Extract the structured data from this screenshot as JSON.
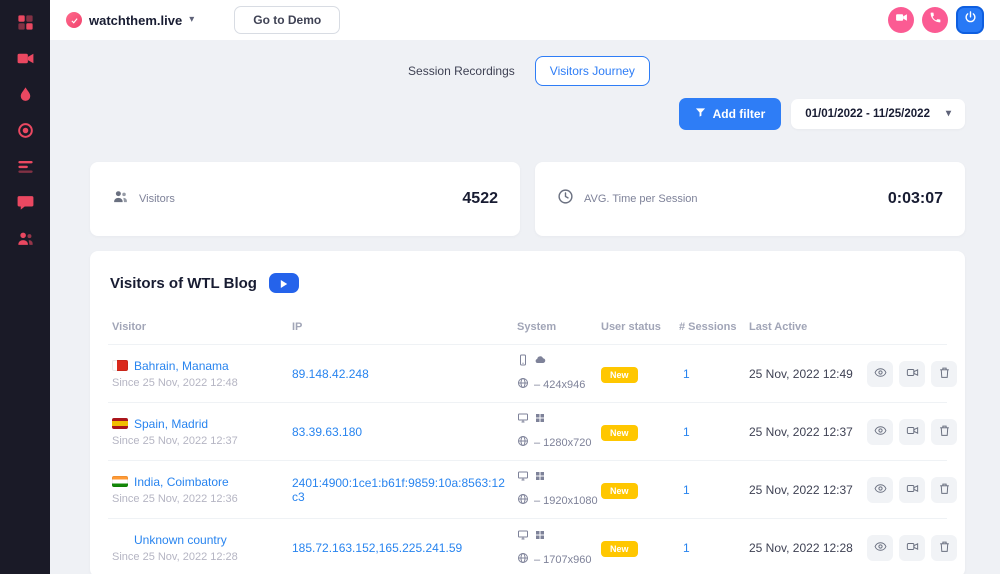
{
  "colors": {
    "accent_pink": "#f1416c",
    "accent_blue": "#2e7df6",
    "badge_yellow": "#ffc700",
    "sidebar_bg": "#1a1a27"
  },
  "icons": {
    "chevron_down": "▾"
  },
  "header": {
    "brand": "watchthem.live",
    "demo_button": "Go to Demo"
  },
  "tabs": {
    "session_recordings": "Session Recordings",
    "visitors_journey": "Visitors Journey"
  },
  "toolbar": {
    "add_filter": "Add filter",
    "date_range": "01/01/2022 - 11/25/2022"
  },
  "stats": {
    "visitors_label": "Visitors",
    "visitors_value": "4522",
    "avg_label": "AVG. Time per Session",
    "avg_value": "0:03:07"
  },
  "table": {
    "title": "Visitors of WTL Blog",
    "columns": [
      "Visitor",
      "IP",
      "System",
      "User status",
      "# Sessions",
      "Last Active"
    ],
    "rows": [
      {
        "location": "Bahrain, Manama",
        "since": "Since 25 Nov, 2022 12:48",
        "ip": "89.148.42.248",
        "resolution": "– 424x946",
        "status": "New",
        "sessions": "1",
        "last_active": "25 Nov, 2022 12:49"
      },
      {
        "location": "Spain, Madrid",
        "since": "Since 25 Nov, 2022 12:37",
        "ip": "83.39.63.180",
        "resolution": "– 1280x720",
        "status": "New",
        "sessions": "1",
        "last_active": "25 Nov, 2022 12:37"
      },
      {
        "location": "India, Coimbatore",
        "since": "Since 25 Nov, 2022 12:36",
        "ip": "2401:4900:1ce1:b61f:9859:10a:8563:12c3",
        "resolution": "– 1920x1080",
        "status": "New",
        "sessions": "1",
        "last_active": "25 Nov, 2022 12:37"
      },
      {
        "location": "Unknown country",
        "since": "Since 25 Nov, 2022 12:28",
        "ip": "185.72.163.152,165.225.241.59",
        "resolution": "– 1707x960",
        "status": "New",
        "sessions": "1",
        "last_active": "25 Nov, 2022 12:28"
      }
    ]
  }
}
